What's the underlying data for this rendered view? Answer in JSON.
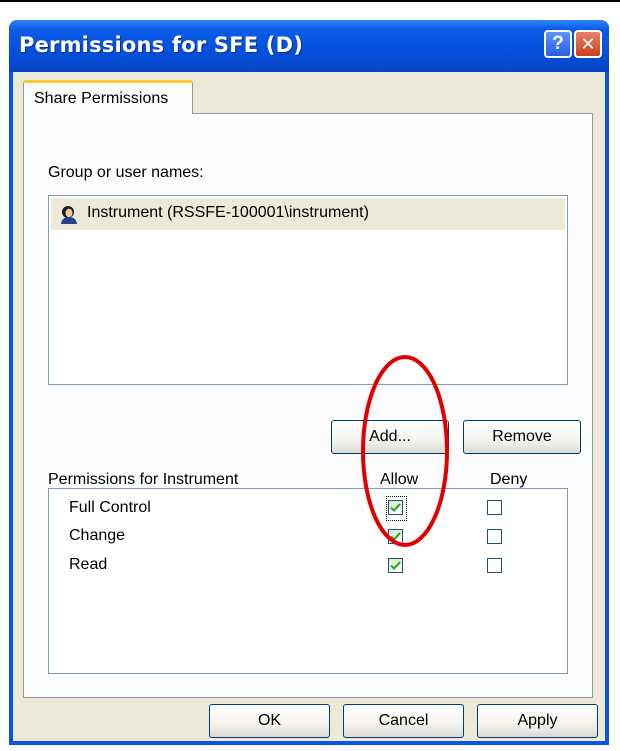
{
  "window": {
    "title": "Permissions for SFE (D)",
    "help_glyph": "?",
    "close_glyph": "✕"
  },
  "tab": {
    "label": "Share Permissions"
  },
  "users": {
    "label": "Group or user names:",
    "items": [
      {
        "name": "Instrument (RSSFE-100001\\instrument)",
        "icon": "user-icon",
        "selected": true
      }
    ],
    "add_label": "Add...",
    "remove_label": "Remove"
  },
  "permissions": {
    "header": "Permissions for Instrument",
    "allow_label": "Allow",
    "deny_label": "Deny",
    "rows": [
      {
        "name": "Full Control",
        "allow": true,
        "deny": false
      },
      {
        "name": "Change",
        "allow": true,
        "deny": false
      },
      {
        "name": "Read",
        "allow": true,
        "deny": false
      }
    ]
  },
  "footer": {
    "ok_label": "OK",
    "cancel_label": "Cancel",
    "apply_label": "Apply"
  },
  "colors": {
    "titlebar": "#0550db",
    "dialog_bg": "#ece9d8",
    "annotation": "#e00000",
    "check": "#21a121"
  }
}
